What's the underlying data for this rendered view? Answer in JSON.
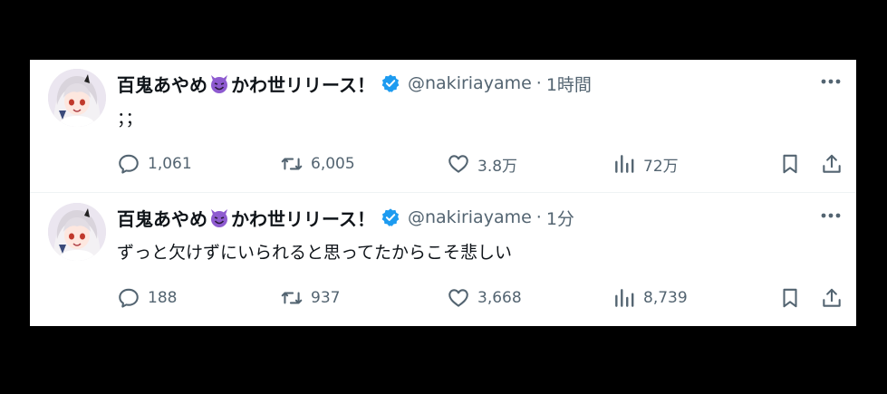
{
  "tweets": [
    {
      "display_name": "百鬼あやめ",
      "display_name_suffix": "かわ世リリース！",
      "handle": "@nakiriayame",
      "separator": "·",
      "time": "1時間",
      "text": "；；",
      "replies": "1,061",
      "retweets": "6,005",
      "likes": "3.8万",
      "views": "72万"
    },
    {
      "display_name": "百鬼あやめ",
      "display_name_suffix": "かわ世リリース！",
      "handle": "@nakiriayame",
      "separator": "·",
      "time": "1分",
      "text": "ずっと欠けずにいられると思ってたからこそ悲しい",
      "replies": "188",
      "retweets": "937",
      "likes": "3,668",
      "views": "8,739"
    }
  ],
  "icons": {
    "verified": "verified-badge-icon",
    "emoji": "smiling-devil-emoji-icon",
    "more": "more-options-icon",
    "reply": "reply-icon",
    "retweet": "retweet-icon",
    "like": "heart-icon",
    "views": "views-chart-icon",
    "bookmark": "bookmark-icon",
    "share": "share-icon"
  },
  "colors": {
    "verified": "#1d9bf0",
    "text": "#0f1419",
    "muted": "#536471",
    "emoji": "#8e5bd0",
    "background": "#000000",
    "panel": "#ffffff"
  }
}
